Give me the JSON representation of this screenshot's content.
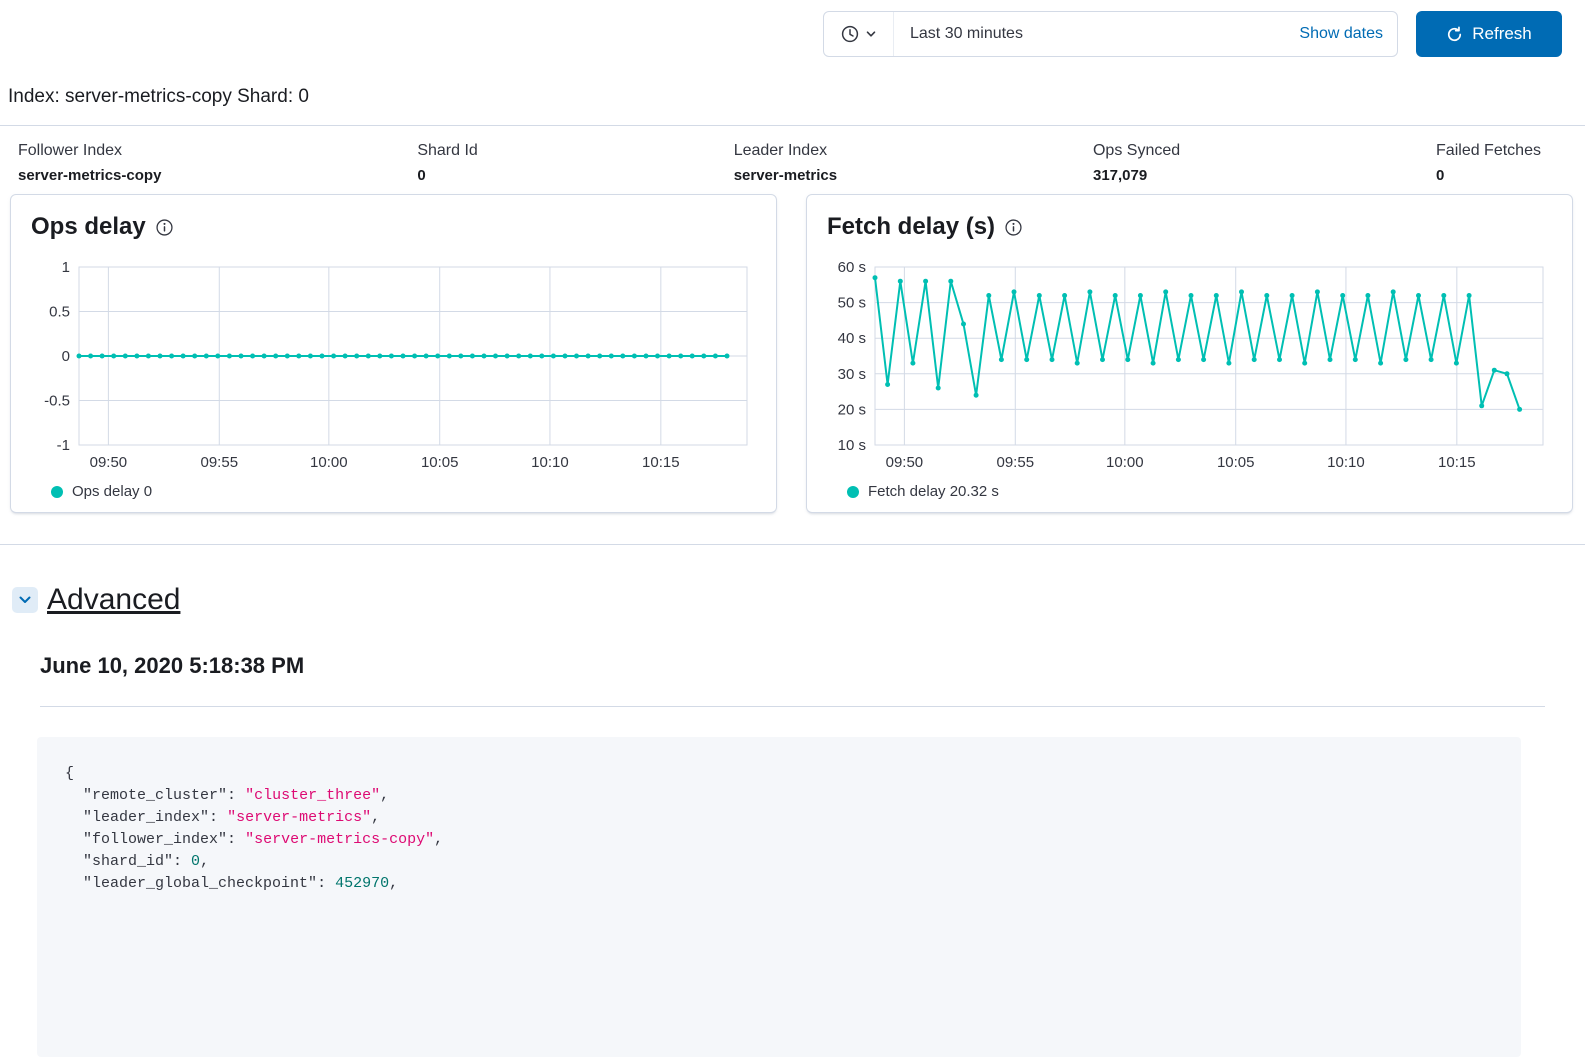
{
  "toolbar": {
    "time_range": "Last 30 minutes",
    "show_dates_label": "Show dates",
    "refresh_label": "Refresh"
  },
  "page": {
    "title": "Index: server-metrics-copy Shard: 0"
  },
  "summary": [
    {
      "label": "Follower Index",
      "value": "server-metrics-copy"
    },
    {
      "label": "Shard Id",
      "value": "0"
    },
    {
      "label": "Leader Index",
      "value": "server-metrics"
    },
    {
      "label": "Ops Synced",
      "value": "317,079"
    },
    {
      "label": "Failed Fetches",
      "value": "0"
    }
  ],
  "chart_data": [
    {
      "type": "line",
      "title": "Ops delay",
      "legend": "Ops delay 0",
      "ylabel": "",
      "xlabel": "",
      "ylim": [
        -1,
        1
      ],
      "y_ticks": [
        1,
        0.5,
        0,
        -0.5,
        -1
      ],
      "y_tick_labels": [
        "1",
        "0.5",
        "0",
        "-0.5",
        "-1"
      ],
      "x_tick_labels": [
        "09:50",
        "09:55",
        "10:00",
        "10:05",
        "10:10",
        "10:15"
      ],
      "x_tick_fractions": [
        0.044,
        0.21,
        0.374,
        0.54,
        0.705,
        0.871
      ],
      "x_span": 0.97,
      "grid": true,
      "legend_position": "bottom-left",
      "line_color": "#00BFB3",
      "grid_color": "#d3dae6",
      "values": [
        0,
        0,
        0,
        0,
        0,
        0,
        0,
        0,
        0,
        0,
        0,
        0,
        0,
        0,
        0,
        0,
        0,
        0,
        0,
        0,
        0,
        0,
        0,
        0,
        0,
        0,
        0,
        0,
        0,
        0,
        0,
        0,
        0,
        0,
        0,
        0,
        0,
        0,
        0,
        0,
        0,
        0,
        0,
        0,
        0,
        0,
        0,
        0,
        0,
        0,
        0,
        0,
        0,
        0,
        0,
        0,
        0
      ]
    },
    {
      "type": "line",
      "title": "Fetch delay (s)",
      "legend": "Fetch delay 20.32 s",
      "ylabel": "",
      "xlabel": "",
      "ylim": [
        10,
        60
      ],
      "y_ticks": [
        60,
        50,
        40,
        30,
        20,
        10
      ],
      "y_tick_labels": [
        "60 s",
        "50 s",
        "40 s",
        "30 s",
        "20 s",
        "10 s"
      ],
      "x_tick_labels": [
        "09:50",
        "09:55",
        "10:00",
        "10:05",
        "10:10",
        "10:15"
      ],
      "x_tick_fractions": [
        0.044,
        0.21,
        0.374,
        0.54,
        0.705,
        0.871
      ],
      "x_span": 0.965,
      "grid": true,
      "legend_position": "bottom-left",
      "line_color": "#00BFB3",
      "grid_color": "#d3dae6",
      "values": [
        57,
        27,
        56,
        33,
        56,
        26,
        56,
        44,
        24,
        52,
        34,
        53,
        34,
        52,
        34,
        52,
        33,
        53,
        34,
        52,
        34,
        52,
        33,
        53,
        34,
        52,
        34,
        52,
        33,
        53,
        34,
        52,
        34,
        52,
        33,
        53,
        34,
        52,
        34,
        52,
        33,
        53,
        34,
        52,
        34,
        52,
        33,
        52,
        21,
        31,
        30,
        20
      ]
    }
  ],
  "advanced": {
    "label": "Advanced",
    "timestamp": "June 10, 2020 5:18:38 PM",
    "code_lines": [
      [
        {
          "t": "p",
          "v": "{"
        }
      ],
      [
        {
          "t": "p",
          "v": "  "
        },
        {
          "t": "k",
          "v": "\"remote_cluster\""
        },
        {
          "t": "p",
          "v": ": "
        },
        {
          "t": "s",
          "v": "\"cluster_three\""
        },
        {
          "t": "p",
          "v": ","
        }
      ],
      [
        {
          "t": "p",
          "v": "  "
        },
        {
          "t": "k",
          "v": "\"leader_index\""
        },
        {
          "t": "p",
          "v": ": "
        },
        {
          "t": "s",
          "v": "\"server-metrics\""
        },
        {
          "t": "p",
          "v": ","
        }
      ],
      [
        {
          "t": "p",
          "v": "  "
        },
        {
          "t": "k",
          "v": "\"follower_index\""
        },
        {
          "t": "p",
          "v": ": "
        },
        {
          "t": "s",
          "v": "\"server-metrics-copy\""
        },
        {
          "t": "p",
          "v": ","
        }
      ],
      [
        {
          "t": "p",
          "v": "  "
        },
        {
          "t": "k",
          "v": "\"shard_id\""
        },
        {
          "t": "p",
          "v": ": "
        },
        {
          "t": "n",
          "v": "0"
        },
        {
          "t": "p",
          "v": ","
        }
      ],
      [
        {
          "t": "p",
          "v": "  "
        },
        {
          "t": "k",
          "v": "\"leader_global_checkpoint\""
        },
        {
          "t": "p",
          "v": ": "
        },
        {
          "t": "n",
          "v": "452970"
        },
        {
          "t": "p",
          "v": ","
        }
      ]
    ]
  },
  "colors": {
    "accent_teal": "#00BFB3",
    "primary_blue": "#006BB4",
    "border_gray": "#d3dae6",
    "string_pink": "#dd0a73",
    "number_teal": "#00756c",
    "code_bg": "#f5f7fa"
  }
}
